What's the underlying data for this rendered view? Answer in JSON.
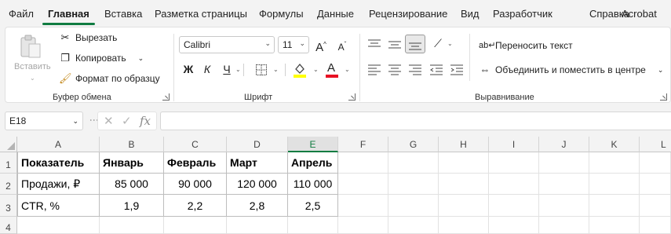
{
  "tabs": [
    "Файл",
    "Главная",
    "Вставка",
    "Разметка страницы",
    "Формулы",
    "Данные",
    "Рецензирование",
    "Вид",
    "Разработчик",
    "Справка",
    "Acrobat"
  ],
  "clipboard": {
    "paste_label": "Вставить",
    "cut_label": "Вырезать",
    "copy_label": "Копировать",
    "format_painter_label": "Формат по образцу",
    "group_label": "Буфер обмена"
  },
  "font": {
    "font_name": "Calibri",
    "font_size": "11",
    "bold_label": "Ж",
    "italic_label": "К",
    "underline_label": "Ч",
    "grow_label": "A",
    "shrink_label": "A",
    "group_label": "Шрифт"
  },
  "alignment": {
    "wrap_label": "Переносить текст",
    "merge_label": "Объединить и поместить в центре",
    "group_label": "Выравнивание"
  },
  "formula_bar": {
    "name_box": "E18",
    "fx_label": "fx",
    "value": ""
  },
  "grid": {
    "columns": [
      "A",
      "B",
      "C",
      "D",
      "E",
      "F",
      "G",
      "H",
      "I",
      "J",
      "K",
      "L"
    ],
    "selected_column": "E",
    "rows": [
      "1",
      "2",
      "3",
      "4"
    ],
    "cells": {
      "r1": [
        "Показатель",
        "Январь",
        "Февраль",
        "Март",
        "Апрель"
      ],
      "r2": [
        "Продажи, ₽",
        "85 000",
        "90 000",
        "120 000",
        "110 000"
      ],
      "r3": [
        "CTR, %",
        "1,9",
        "2,2",
        "2,8",
        "2,5"
      ]
    }
  },
  "colors": {
    "accent": "#107c41",
    "fill_color": "#ffff00",
    "font_color": "#e81123"
  }
}
